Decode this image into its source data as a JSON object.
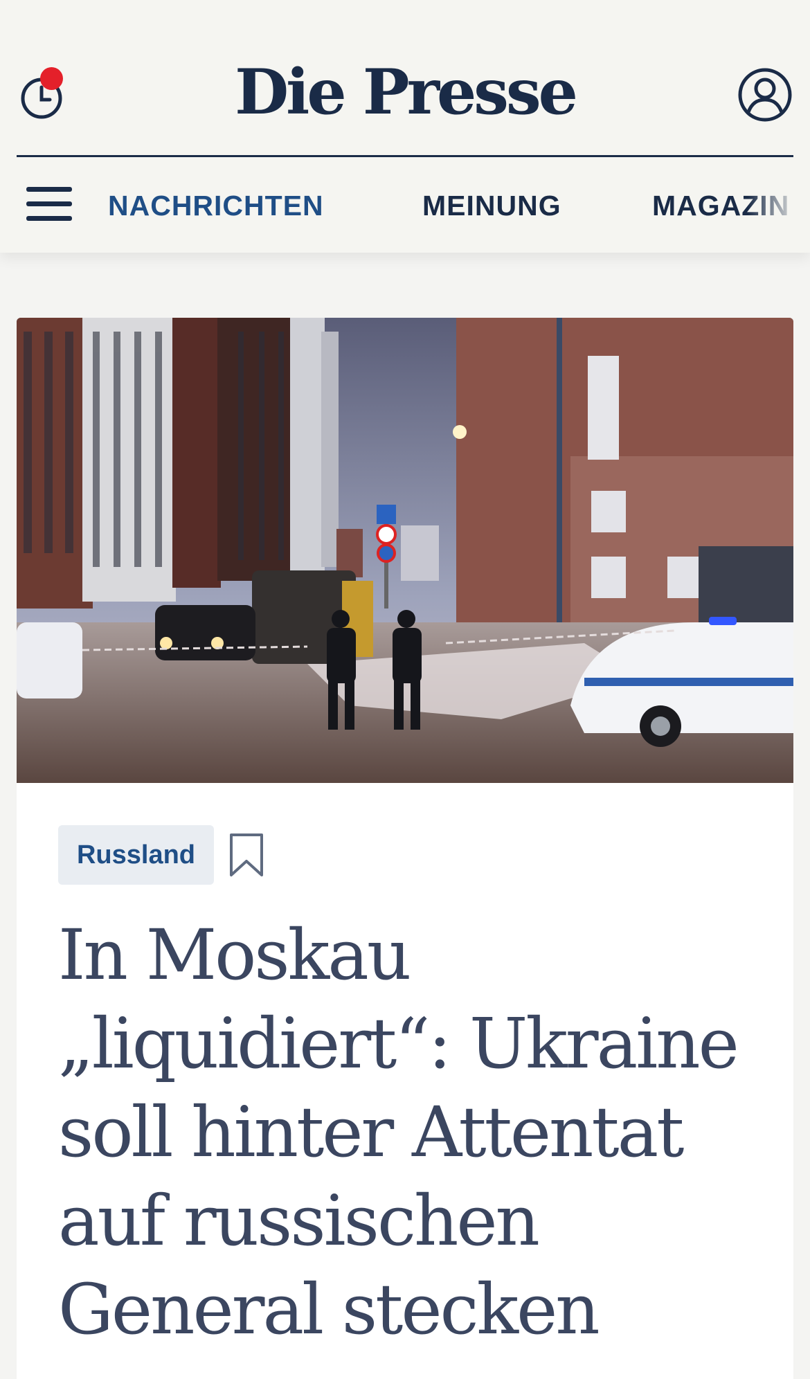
{
  "brand": {
    "logo_text": "Die Presse",
    "primary_color": "#1a2b47",
    "accent_color": "#1f4e86",
    "notification_color": "#e4202a"
  },
  "header": {
    "history_icon": "clock-history-icon",
    "account_icon": "user-account-icon",
    "menu_icon": "hamburger-menu-icon"
  },
  "nav": {
    "items": [
      {
        "label": "NACHRICHTEN",
        "active": true,
        "color": "#1f4e86"
      },
      {
        "label": "MEINUNG",
        "active": false,
        "color": "#1a2b47"
      },
      {
        "label": "MAGAZIN",
        "active": false,
        "color": "#1a2b47"
      }
    ]
  },
  "article": {
    "tag": "Russland",
    "bookmark_icon": "bookmark-icon",
    "headline": "In Moskau „liquidiert“: Ukraine soll hinter Attentat auf russischen General stecken"
  }
}
